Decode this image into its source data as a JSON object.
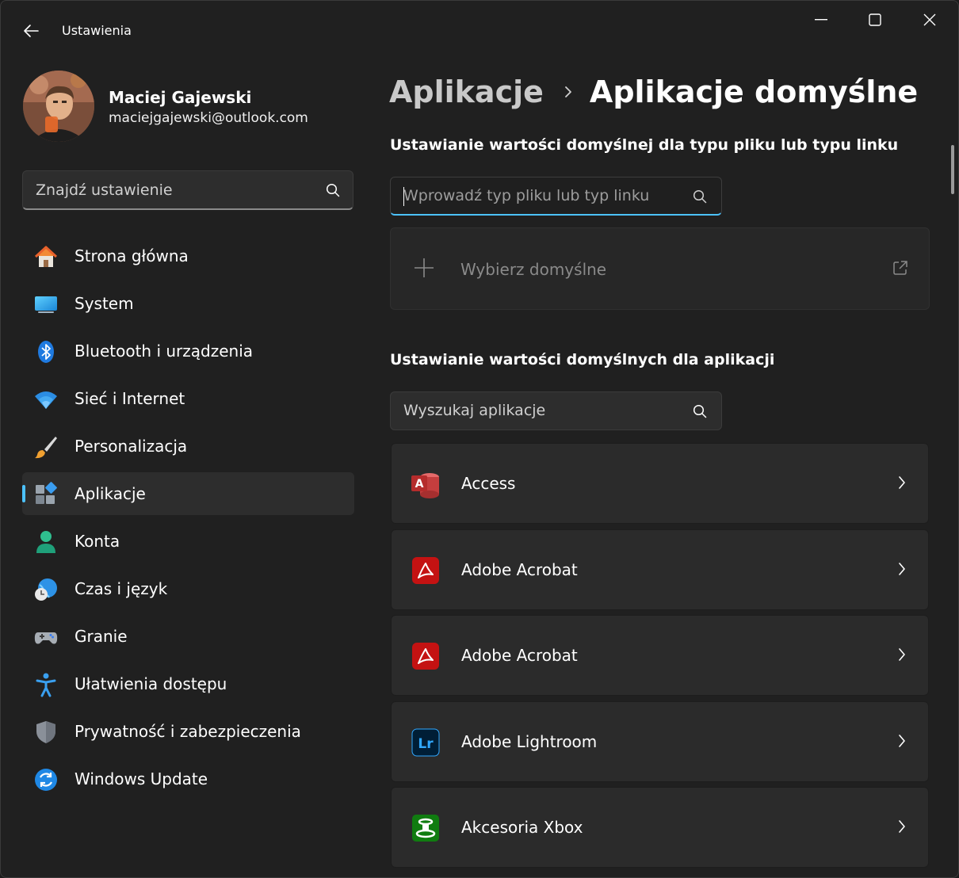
{
  "window": {
    "title": "Ustawienia"
  },
  "profile": {
    "name": "Maciej Gajewski",
    "email": "maciejgajewski@outlook.com"
  },
  "sidebar": {
    "search_placeholder": "Znajdź ustawienie",
    "items": [
      {
        "label": "Strona główna",
        "icon": "home-icon"
      },
      {
        "label": "System",
        "icon": "monitor-icon"
      },
      {
        "label": "Bluetooth i urządzenia",
        "icon": "bluetooth-icon"
      },
      {
        "label": "Sieć i Internet",
        "icon": "wifi-icon"
      },
      {
        "label": "Personalizacja",
        "icon": "brush-icon"
      },
      {
        "label": "Aplikacje",
        "icon": "apps-icon",
        "active": true
      },
      {
        "label": "Konta",
        "icon": "person-icon"
      },
      {
        "label": "Czas i język",
        "icon": "globe-clock-icon"
      },
      {
        "label": "Granie",
        "icon": "gamepad-icon"
      },
      {
        "label": "Ułatwienia dostępu",
        "icon": "accessibility-icon"
      },
      {
        "label": "Prywatność i zabezpieczenia",
        "icon": "shield-icon"
      },
      {
        "label": "Windows Update",
        "icon": "update-icon"
      }
    ]
  },
  "main": {
    "breadcrumb": {
      "parent": "Aplikacje",
      "current": "Aplikacje domyślne"
    },
    "filetype_section": {
      "title": "Ustawianie wartości domyślnej dla typu pliku lub typu linku",
      "search_placeholder": "Wprowadź typ pliku lub typ linku",
      "choose_label": "Wybierz domyślne"
    },
    "apps_section": {
      "title": "Ustawianie wartości domyślnych dla aplikacji",
      "search_placeholder": "Wyszukaj aplikacje",
      "apps": [
        {
          "name": "Access",
          "icon": "access-icon"
        },
        {
          "name": "Adobe Acrobat",
          "icon": "acrobat-icon"
        },
        {
          "name": "Adobe Acrobat",
          "icon": "acrobat-icon"
        },
        {
          "name": "Adobe Lightroom",
          "icon": "lightroom-icon"
        },
        {
          "name": "Akcesoria Xbox",
          "icon": "xbox-accessories-icon"
        }
      ]
    }
  },
  "colors": {
    "accent": "#4cc2ff",
    "background": "#202020",
    "card": "#2b2b2b"
  }
}
